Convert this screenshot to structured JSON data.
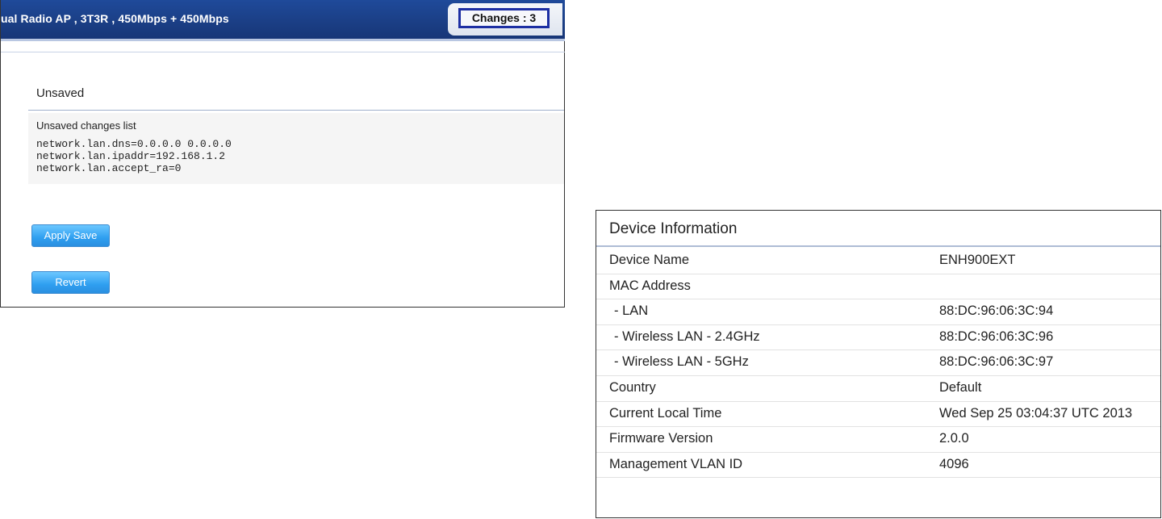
{
  "header": {
    "device_model": "ual Radio AP , 3T3R , 450Mbps + 450Mbps",
    "changes_label": "Changes : 3"
  },
  "unsaved": {
    "heading": "Unsaved",
    "list_label": "Unsaved changes list",
    "changes": [
      "network.lan.dns=0.0.0.0 0.0.0.0",
      "network.lan.ipaddr=192.168.1.2",
      "network.lan.accept_ra=0"
    ]
  },
  "buttons": {
    "apply_save": "Apply Save",
    "revert": "Revert"
  },
  "device_info": {
    "title": "Device Information",
    "rows": [
      {
        "label": "Device Name",
        "value": "ENH900EXT"
      },
      {
        "label": "MAC Address",
        "value": ""
      },
      {
        "label": "- LAN",
        "value": "88:DC:96:06:3C:94"
      },
      {
        "label": "- Wireless LAN - 2.4GHz",
        "value": "88:DC:96:06:3C:96"
      },
      {
        "label": "- Wireless LAN - 5GHz",
        "value": "88:DC:96:06:3C:97"
      },
      {
        "label": "Country",
        "value": "Default"
      },
      {
        "label": "Current Local Time",
        "value": "Wed Sep 25 03:04:37 UTC 2013"
      },
      {
        "label": "Firmware Version",
        "value": "2.0.0"
      },
      {
        "label": "Management VLAN ID",
        "value": "4096"
      }
    ]
  },
  "colors": {
    "header_blue": "#1b3f86",
    "changes_border": "#1d2fa3",
    "button_blue": "#2f9ff0"
  }
}
